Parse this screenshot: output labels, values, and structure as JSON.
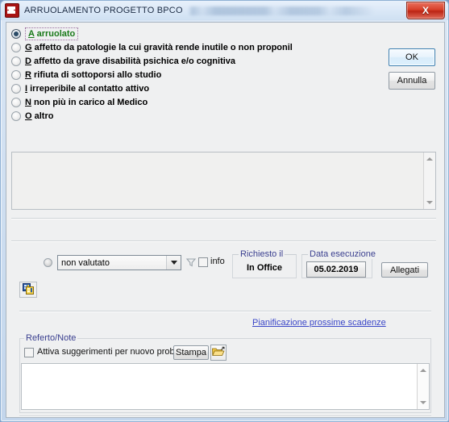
{
  "window": {
    "title": "ARRUOLAMENTO PROGETTO BPCO",
    "title_redacted_note": "",
    "app_icon": "castle-icon",
    "close_label": "X"
  },
  "buttons": {
    "ok": "OK",
    "annulla": "Annulla",
    "allegati": "Allegati",
    "stampa": "Stampa",
    "date": "05.02.2019"
  },
  "options": [
    {
      "code": "A",
      "mnemonic": "A",
      "text": " arruolato",
      "selected": true
    },
    {
      "code": "G",
      "mnemonic": "G",
      "text": " affetto da patologie la cui gravità rende inutile o non proponil",
      "selected": false
    },
    {
      "code": "D",
      "mnemonic": "D",
      "text": " affetto da grave disabilità psichica e/o cognitiva",
      "selected": false
    },
    {
      "code": "R",
      "mnemonic": "R",
      "text": " rifiuta di sottoporsi allo studio",
      "selected": false
    },
    {
      "code": "I",
      "mnemonic": "I",
      "text": " irreperibile al contatto attivo",
      "selected": false
    },
    {
      "code": "N",
      "mnemonic": "N",
      "text": " non più in carico al Medico",
      "selected": false
    },
    {
      "code": "O",
      "mnemonic": "O",
      "text": " altro",
      "selected": false
    }
  ],
  "note_box": {
    "value": "",
    "placeholder": ""
  },
  "evaluation": {
    "combo_value": "non valutato",
    "combo_arrow": "▼",
    "info_label": "info",
    "info_checked": false,
    "funnel_icon": "filter-funnel-icon",
    "copy_icon": "copy-records-icon"
  },
  "requested": {
    "caption": "Richiesto il",
    "value": "In Office"
  },
  "execution": {
    "caption": "Data esecuzione",
    "value": "05.02.2019"
  },
  "link": {
    "label": "Pianificazione prossime scadenze"
  },
  "referto": {
    "caption": "Referto/Note",
    "suggestion_label": "Attiva suggerimenti per nuovo problema",
    "suggestion_checked": false,
    "folder_icon": "open-folder-icon",
    "textarea_value": "",
    "textarea_placeholder": ""
  },
  "colors": {
    "selected_option_text": "#1a7a1a",
    "caption_text": "#3a3f8f",
    "link_text": "#3a46c8",
    "close_button": "#c62f1c",
    "window_border": "#8fb0d4"
  }
}
